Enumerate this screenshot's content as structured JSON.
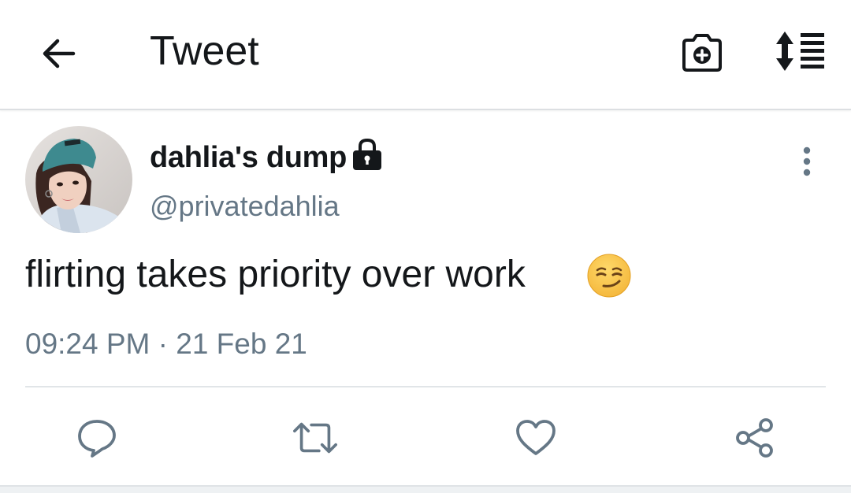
{
  "header": {
    "title": "Tweet",
    "back_icon": "arrow-left-icon",
    "camera_icon": "camera-add-icon",
    "sort_icon": "sort-lines-icon"
  },
  "tweet": {
    "display_name": "dahlia's dump",
    "protected_icon": "lock-icon",
    "handle": "@privatedahlia",
    "text": "flirting takes priority over work",
    "emoji": "smirking-face-emoji",
    "timestamp": "09:24 PM · 21 Feb 21",
    "more_icon": "vertical-ellipsis-icon"
  },
  "actions": {
    "reply_icon": "reply-bubble-icon",
    "retweet_icon": "retweet-icon",
    "like_icon": "heart-icon",
    "share_icon": "share-icon"
  },
  "colors": {
    "text_primary": "#14171a",
    "text_secondary": "#657786",
    "icon_gray": "#657786",
    "divider": "#e1e5e8"
  }
}
